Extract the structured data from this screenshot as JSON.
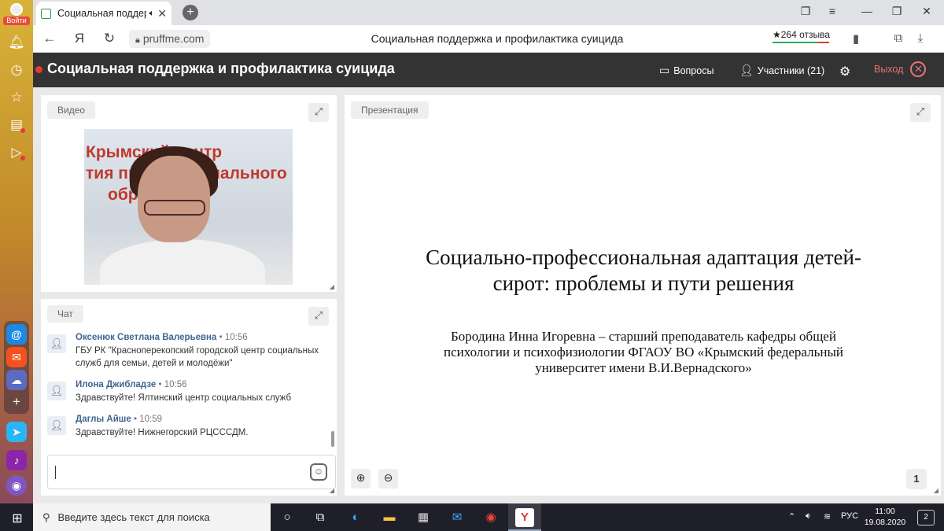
{
  "sidebar": {
    "login_label": "Войти"
  },
  "browser": {
    "tab_title": "Социальная поддерж",
    "url": "pruffme.com",
    "page_title": "Социальная поддержка и профилактика суицида",
    "reviews": "★264 отзыва",
    "yandex_letter": "Я"
  },
  "app": {
    "title": "Социальная поддержка и профилактика суицида",
    "questions_label": "Вопросы",
    "participants_label": "Участники (21)",
    "exit_label": "Выход"
  },
  "video_panel": {
    "tag": "Видео",
    "bg_text_lines": [
      "Крымский центр",
      "тия профессионального",
      "обр ания"
    ]
  },
  "chat_panel": {
    "tag": "Чат",
    "messages": [
      {
        "name": "Оксенюк Светлана Валерьевна",
        "time": "• 10:56",
        "text": "ГБУ РК \"Красноперекопский городской центр социальных служб для семьи, детей и молодёжи\""
      },
      {
        "name": "Илона Джибладзе",
        "time": "• 10:56",
        "text": "Здравствуйте! Ялтинский центр социальных служб"
      },
      {
        "name": "Даглы Айше",
        "time": "• 10:59",
        "text": "Здравствуйте! Нижнегорский РЦСССДМ."
      }
    ],
    "input_value": ""
  },
  "presentation_panel": {
    "tag": "Презентация",
    "slide_title": "Социально-профессиональная адаптация детей-сирот: проблемы и пути решения",
    "slide_author": "Бородина Инна Игоревна – старший преподаватель кафедры общей психологии и психофизиологии ФГАОУ ВО «Крымский федеральный университет имени В.И.Вернадского»",
    "page_number": "1"
  },
  "taskbar": {
    "search_placeholder": "Введите здесь текст для поиска",
    "language": "РУС",
    "time": "11:00",
    "date": "19.08.2020",
    "notifications": "2"
  }
}
